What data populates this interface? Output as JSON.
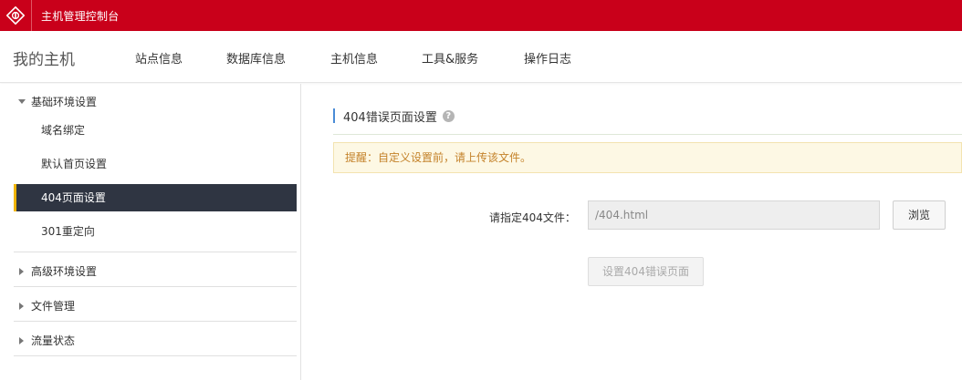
{
  "topbar": {
    "title": "主机管理控制台",
    "logo_icon": "brand-logo-icon"
  },
  "nav": {
    "brand": "我的主机",
    "items": [
      "站点信息",
      "数据库信息",
      "主机信息",
      "工具&服务",
      "操作日志"
    ]
  },
  "sidebar": {
    "groups": [
      {
        "label": "基础环境设置",
        "expanded": true,
        "items": [
          "域名绑定",
          "默认首页设置",
          "404页面设置",
          "301重定向"
        ],
        "active_item": "404页面设置"
      },
      {
        "label": "高级环境设置",
        "expanded": false
      },
      {
        "label": "文件管理",
        "expanded": false
      },
      {
        "label": "流量状态",
        "expanded": false
      }
    ]
  },
  "main": {
    "section_title": "404错误页面设置",
    "help_glyph": "?",
    "notice": "提醒：自定义设置前，请上传该文件。",
    "field_label": "请指定404文件：",
    "file_value": "/404.html",
    "browse_label": "浏览",
    "submit_label": "设置404错误页面"
  },
  "colors": {
    "brand_red": "#c9001a",
    "active_bg": "#2f3542",
    "active_accent": "#f0b400",
    "notice_bg": "#fdf8e4",
    "notice_text": "#c4822a"
  }
}
